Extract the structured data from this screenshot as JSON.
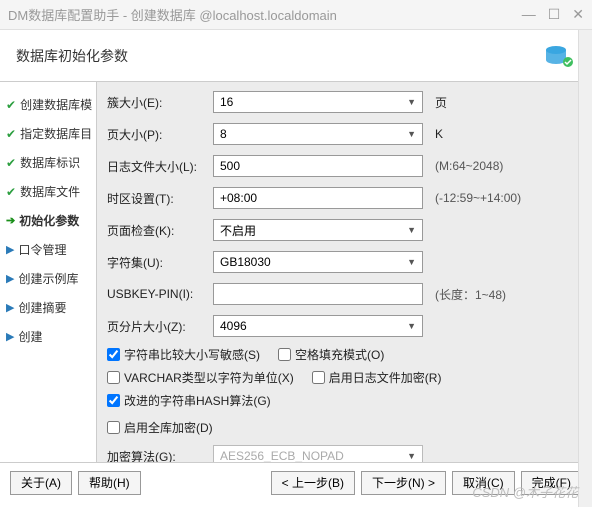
{
  "titlebar": {
    "title": "DM数据库配置助手 - 创建数据库 @localhost.localdomain"
  },
  "header": {
    "title": "数据库初始化参数"
  },
  "sidebar": {
    "items": [
      {
        "label": "创建数据库模",
        "state": "done"
      },
      {
        "label": "指定数据库目",
        "state": "done"
      },
      {
        "label": "数据库标识",
        "state": "done"
      },
      {
        "label": "数据库文件",
        "state": "done"
      },
      {
        "label": "初始化参数",
        "state": "active"
      },
      {
        "label": "口令管理",
        "state": "pending"
      },
      {
        "label": "创建示例库",
        "state": "pending"
      },
      {
        "label": "创建摘要",
        "state": "pending"
      },
      {
        "label": "创建",
        "state": "pending"
      }
    ]
  },
  "form": {
    "extent_size": {
      "label": "簇大小(E):",
      "value": "16",
      "unit": "页"
    },
    "page_size": {
      "label": "页大小(P):",
      "value": "8",
      "unit": "K"
    },
    "log_size": {
      "label": "日志文件大小(L):",
      "value": "500",
      "hint": "(M:64~2048)"
    },
    "timezone": {
      "label": "时区设置(T):",
      "value": "+08:00",
      "hint": "(-12:59~+14:00)"
    },
    "page_check": {
      "label": "页面检查(K):",
      "value": "不启用"
    },
    "charset": {
      "label": "字符集(U):",
      "value": "GB18030"
    },
    "usbkey": {
      "label": "USBKEY-PIN(I):",
      "value": "",
      "hint": "(长度：1~48)"
    },
    "slice_size": {
      "label": "页分片大小(Z):",
      "value": "4096"
    },
    "checks": {
      "case_sensitive": {
        "label": "字符串比较大小写敏感(S)",
        "checked": true
      },
      "blank_pad": {
        "label": "空格填充模式(O)",
        "checked": false
      },
      "varchar_char": {
        "label": "VARCHAR类型以字符为单位(X)",
        "checked": false
      },
      "log_encrypt": {
        "label": "启用日志文件加密(R)",
        "checked": false
      },
      "hash_improved": {
        "label": "改进的字符串HASH算法(G)",
        "checked": true
      },
      "db_encrypt": {
        "label": "启用全库加密(D)",
        "checked": false
      }
    },
    "encrypt_algo": {
      "label": "加密算法(G):",
      "value": "AES256_ECB_NOPAD"
    }
  },
  "footer": {
    "about": "关于(A)",
    "help": "帮助(H)",
    "prev": "< 上一步(B)",
    "next": "下一步(N) >",
    "cancel": "取消(C)",
    "finish": "完成(F)"
  },
  "watermark": "CSDN @木子花花"
}
